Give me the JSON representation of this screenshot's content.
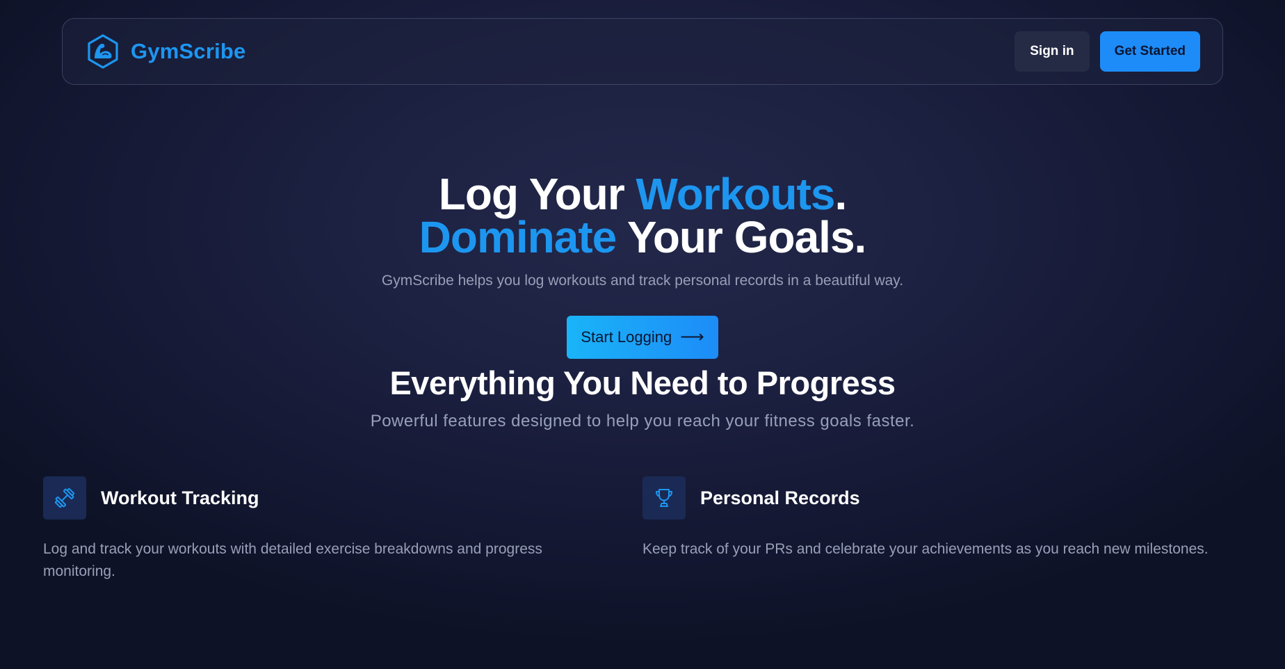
{
  "brand": {
    "name": "GymScribe",
    "logo_icon": "flexed-arm-hexagon-icon",
    "color": "#1d96f0"
  },
  "nav": {
    "signin_label": "Sign in",
    "get_started_label": "Get Started"
  },
  "hero": {
    "title_line1_part1": "Log Your ",
    "title_line1_accent": "Workouts",
    "title_line1_end": ".",
    "title_line2_accent": "Dominate",
    "title_line2_part2": " Your Goals.",
    "subtitle": "GymScribe helps you log workouts and track personal records in a beautiful way.",
    "cta_label": "Start Logging",
    "cta_icon": "arrow-right-icon",
    "cta_arrow": "⟶"
  },
  "features": {
    "title": "Everything You Need to Progress",
    "subtitle": "Powerful features designed to help you reach your fitness goals faster.",
    "items": [
      {
        "icon": "dumbbell-icon",
        "title": "Workout Tracking",
        "description": "Log and track your workouts with detailed exercise breakdowns and progress monitoring."
      },
      {
        "icon": "trophy-icon",
        "title": "Personal Records",
        "description": "Keep track of your PRs and celebrate your achievements as you reach new milestones."
      }
    ]
  },
  "colors": {
    "accent": "#1d96f0",
    "primary_button": "#1d8cf8",
    "background": "#1c2040",
    "muted_text": "#98a0b8"
  }
}
